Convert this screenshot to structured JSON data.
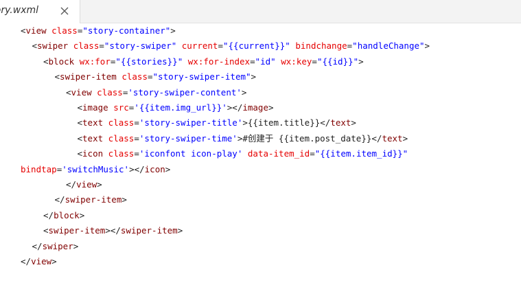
{
  "tab": {
    "label": "story.wxml",
    "close_icon": "close-icon"
  },
  "colors": {
    "punct": "#1e1e1e",
    "tag": "#800000",
    "attr": "#e50000",
    "string": "#0000ff",
    "text": "#1e1e1e"
  },
  "code_lines": [
    {
      "indent": 0,
      "tokens": [
        [
          "p",
          "<"
        ],
        [
          "n",
          "view"
        ],
        [
          "t",
          " "
        ],
        [
          "a",
          "class"
        ],
        [
          "p",
          "="
        ],
        [
          "s",
          "\"story-container\""
        ],
        [
          "p",
          ">"
        ]
      ]
    },
    {
      "indent": 1,
      "tokens": [
        [
          "p",
          "<"
        ],
        [
          "n",
          "swiper"
        ],
        [
          "t",
          " "
        ],
        [
          "a",
          "class"
        ],
        [
          "p",
          "="
        ],
        [
          "s",
          "\"story-swiper\""
        ],
        [
          "t",
          " "
        ],
        [
          "a",
          "current"
        ],
        [
          "p",
          "="
        ],
        [
          "s",
          "\"{{current}}\""
        ],
        [
          "t",
          " "
        ],
        [
          "a",
          "bindchange"
        ],
        [
          "p",
          "="
        ],
        [
          "s",
          "\"handleChange\""
        ],
        [
          "p",
          ">"
        ]
      ]
    },
    {
      "indent": 2,
      "tokens": [
        [
          "p",
          "<"
        ],
        [
          "n",
          "block"
        ],
        [
          "t",
          " "
        ],
        [
          "a",
          "wx:for"
        ],
        [
          "p",
          "="
        ],
        [
          "s",
          "\"{{stories}}\""
        ],
        [
          "t",
          " "
        ],
        [
          "a",
          "wx:for-index"
        ],
        [
          "p",
          "="
        ],
        [
          "s",
          "\"id\""
        ],
        [
          "t",
          " "
        ],
        [
          "a",
          "wx:key"
        ],
        [
          "p",
          "="
        ],
        [
          "s",
          "\"{{id}}\""
        ],
        [
          "p",
          ">"
        ]
      ]
    },
    {
      "indent": 3,
      "tokens": [
        [
          "p",
          "<"
        ],
        [
          "n",
          "swiper-item"
        ],
        [
          "t",
          " "
        ],
        [
          "a",
          "class"
        ],
        [
          "p",
          "="
        ],
        [
          "s",
          "\"story-swiper-item\""
        ],
        [
          "p",
          ">"
        ]
      ]
    },
    {
      "indent": 4,
      "tokens": [
        [
          "p",
          "<"
        ],
        [
          "n",
          "view"
        ],
        [
          "t",
          " "
        ],
        [
          "a",
          "class"
        ],
        [
          "p",
          "="
        ],
        [
          "s",
          "'story-swiper-content'"
        ],
        [
          "p",
          ">"
        ]
      ]
    },
    {
      "indent": 5,
      "tokens": [
        [
          "p",
          "<"
        ],
        [
          "n",
          "image"
        ],
        [
          "t",
          " "
        ],
        [
          "a",
          "src"
        ],
        [
          "p",
          "="
        ],
        [
          "s",
          "'{{item.img_url}}'"
        ],
        [
          "p",
          "></"
        ],
        [
          "n",
          "image"
        ],
        [
          "p",
          ">"
        ]
      ]
    },
    {
      "indent": 5,
      "tokens": [
        [
          "p",
          "<"
        ],
        [
          "n",
          "text"
        ],
        [
          "t",
          " "
        ],
        [
          "a",
          "class"
        ],
        [
          "p",
          "="
        ],
        [
          "s",
          "'story-swiper-title'"
        ],
        [
          "p",
          ">"
        ],
        [
          "t",
          "{{item.title}}"
        ],
        [
          "p",
          "</"
        ],
        [
          "n",
          "text"
        ],
        [
          "p",
          ">"
        ]
      ]
    },
    {
      "indent": 5,
      "tokens": [
        [
          "p",
          "<"
        ],
        [
          "n",
          "text"
        ],
        [
          "t",
          " "
        ],
        [
          "a",
          "class"
        ],
        [
          "p",
          "="
        ],
        [
          "s",
          "'story-swiper-time'"
        ],
        [
          "p",
          ">"
        ],
        [
          "t",
          "#创建于 {{item.post_date}}"
        ],
        [
          "p",
          "</"
        ],
        [
          "n",
          "text"
        ],
        [
          "p",
          ">"
        ]
      ]
    },
    {
      "indent": 5,
      "tokens": [
        [
          "p",
          "<"
        ],
        [
          "n",
          "icon"
        ],
        [
          "t",
          " "
        ],
        [
          "a",
          "class"
        ],
        [
          "p",
          "="
        ],
        [
          "s",
          "'iconfont icon-play'"
        ],
        [
          "t",
          " "
        ],
        [
          "a",
          "data-item_id"
        ],
        [
          "p",
          "="
        ],
        [
          "s",
          "\"{{item.item_id}}\""
        ]
      ]
    },
    {
      "indent": -1,
      "tokens": [
        [
          "a",
          "bindtap"
        ],
        [
          "p",
          "="
        ],
        [
          "s",
          "'switchMusic'"
        ],
        [
          "p",
          "></"
        ],
        [
          "n",
          "icon"
        ],
        [
          "p",
          ">"
        ]
      ]
    },
    {
      "indent": 4,
      "tokens": [
        [
          "p",
          "</"
        ],
        [
          "n",
          "view"
        ],
        [
          "p",
          ">"
        ]
      ]
    },
    {
      "indent": 3,
      "tokens": [
        [
          "p",
          "</"
        ],
        [
          "n",
          "swiper-item"
        ],
        [
          "p",
          ">"
        ]
      ]
    },
    {
      "indent": 2,
      "tokens": [
        [
          "p",
          "</"
        ],
        [
          "n",
          "block"
        ],
        [
          "p",
          ">"
        ]
      ]
    },
    {
      "indent": 2,
      "tokens": [
        [
          "p",
          "<"
        ],
        [
          "n",
          "swiper-item"
        ],
        [
          "p",
          "></"
        ],
        [
          "n",
          "swiper-item"
        ],
        [
          "p",
          ">"
        ]
      ]
    },
    {
      "indent": 1,
      "tokens": [
        [
          "p",
          "</"
        ],
        [
          "n",
          "swiper"
        ],
        [
          "p",
          ">"
        ]
      ]
    },
    {
      "indent": 0,
      "tokens": [
        [
          "p",
          "</"
        ],
        [
          "n",
          "view"
        ],
        [
          "p",
          ">"
        ]
      ]
    }
  ]
}
